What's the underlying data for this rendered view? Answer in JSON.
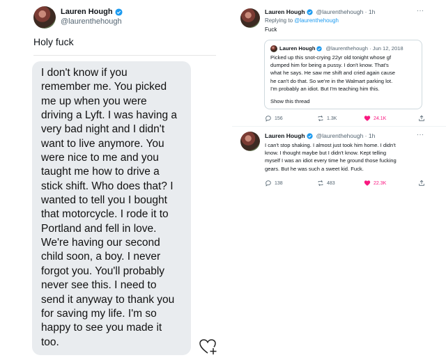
{
  "left": {
    "author": {
      "name": "Lauren Hough",
      "handle": "@laurenthehough"
    },
    "tweet_text": "Holy fuck",
    "message_lines": [
      "I don't know if you",
      "remember me. You picked",
      "me up when you were",
      "driving a Lyft. I was having a",
      "very bad night and I didn't",
      "want to live anymore. You",
      "were nice to me and you",
      "taught me how to drive a",
      "stick shift. Who does that? I",
      "wanted to tell you I bought",
      "that motorcycle. I rode it to",
      "Portland and fell in love.",
      "We're having our second",
      "child soon, a boy. I never",
      "forgot you. You'll probably",
      "never see this. I need to",
      "send it anyway to thank you",
      "for saving my life. I'm so",
      "happy to see you made it",
      "too."
    ]
  },
  "right": {
    "reply": {
      "name": "Lauren Hough",
      "meta": "@laurenthehough · 1h",
      "more": "···",
      "replying_prefix": "Replying to ",
      "replying_handle": "@laurenthehough",
      "text": "Fuck",
      "quote": {
        "name": "Lauren Hough",
        "meta": "@laurenthehough · Jun 12, 2018",
        "lines": [
          "Picked up this snot-crying 22yr old tonight whose gf",
          "dumped him for being a pussy. I don't know. That's",
          "what he says. He saw me shift and cried again cause",
          "he can't do that. So we're in the Walmart parking lot.",
          "I'm probably an idiot. But I'm teaching him this."
        ],
        "show_thread": "Show this thread"
      },
      "stats": {
        "replies": "156",
        "retweets": "1.3K",
        "likes": "24.1K"
      }
    },
    "followup": {
      "name": "Lauren Hough",
      "meta": "@laurenthehough · 1h",
      "more": "···",
      "lines": [
        "I can't stop shaking. I almost just took him home. I didn't",
        "know. I thought maybe but I didn't know. Kept telling",
        "myself I was an idiot every time he ground those fucking",
        "gears. But he was such a sweet kid. Fuck."
      ],
      "stats": {
        "replies": "138",
        "retweets": "483",
        "likes": "22.3K"
      }
    }
  },
  "colors": {
    "verified": "#1d9bf0",
    "like": "#f91880",
    "link": "#1d9bf0",
    "bubble": "#e9ecef"
  },
  "icons": [
    "verified-badge-icon",
    "reply-icon",
    "retweet-icon",
    "heart-icon",
    "share-icon",
    "more-icon",
    "heart-plus-icon"
  ]
}
